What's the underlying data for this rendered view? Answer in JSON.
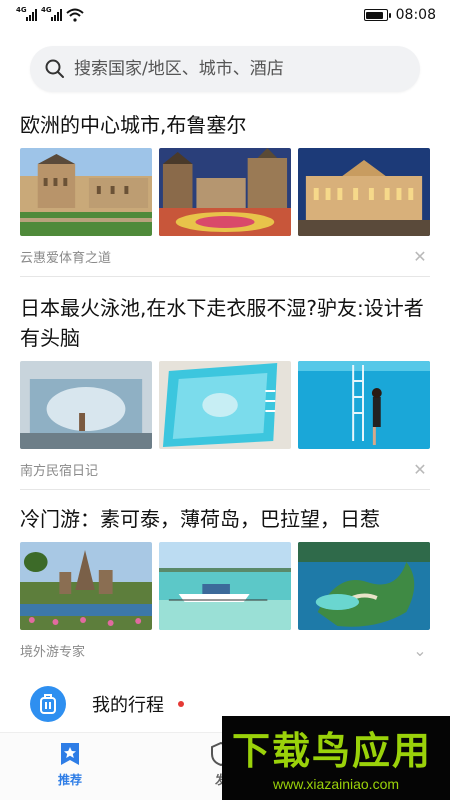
{
  "status_bar": {
    "network_1": "4G",
    "network_2": "4G",
    "time": "08:08",
    "battery_level": 0.9
  },
  "search": {
    "placeholder": "搜索国家/地区、城市、酒店"
  },
  "articles": [
    {
      "title": "欧洲的中心城市,布鲁塞尔",
      "source": "云惠爱体育之道",
      "thumbnails": [
        "palace-garden-photo",
        "grand-place-flower-carpet-photo",
        "royal-palace-photo"
      ]
    },
    {
      "title": "日本最火泳池,在水下走衣服不湿?驴友:设计者有头脑",
      "source": "南方民宿日记",
      "thumbnails": [
        "pool-underwater-view-photo",
        "pool-top-view-photo",
        "pool-ladder-photo"
      ]
    },
    {
      "title": "冷门游：素可泰，薄荷岛，巴拉望，日惹",
      "source": "境外游专家",
      "thumbnails": [
        "sukhothai-temple-photo",
        "bohol-boat-photo",
        "palawan-island-photo"
      ]
    }
  ],
  "trip": {
    "label": "我的行程"
  },
  "bottom_nav": [
    {
      "label": "推荐",
      "icon": "star-tag-icon",
      "active": true
    },
    {
      "label": "发",
      "icon": "shield-icon",
      "active": false
    }
  ],
  "watermark": {
    "logo_text": "下载鸟应用",
    "url": "www.xiazainiao.com"
  },
  "colors": {
    "accent": "#2e7de6",
    "trip_circle": "#2e8ff0",
    "notification_dot": "#e53935",
    "watermark_green": "#9ad20a"
  }
}
